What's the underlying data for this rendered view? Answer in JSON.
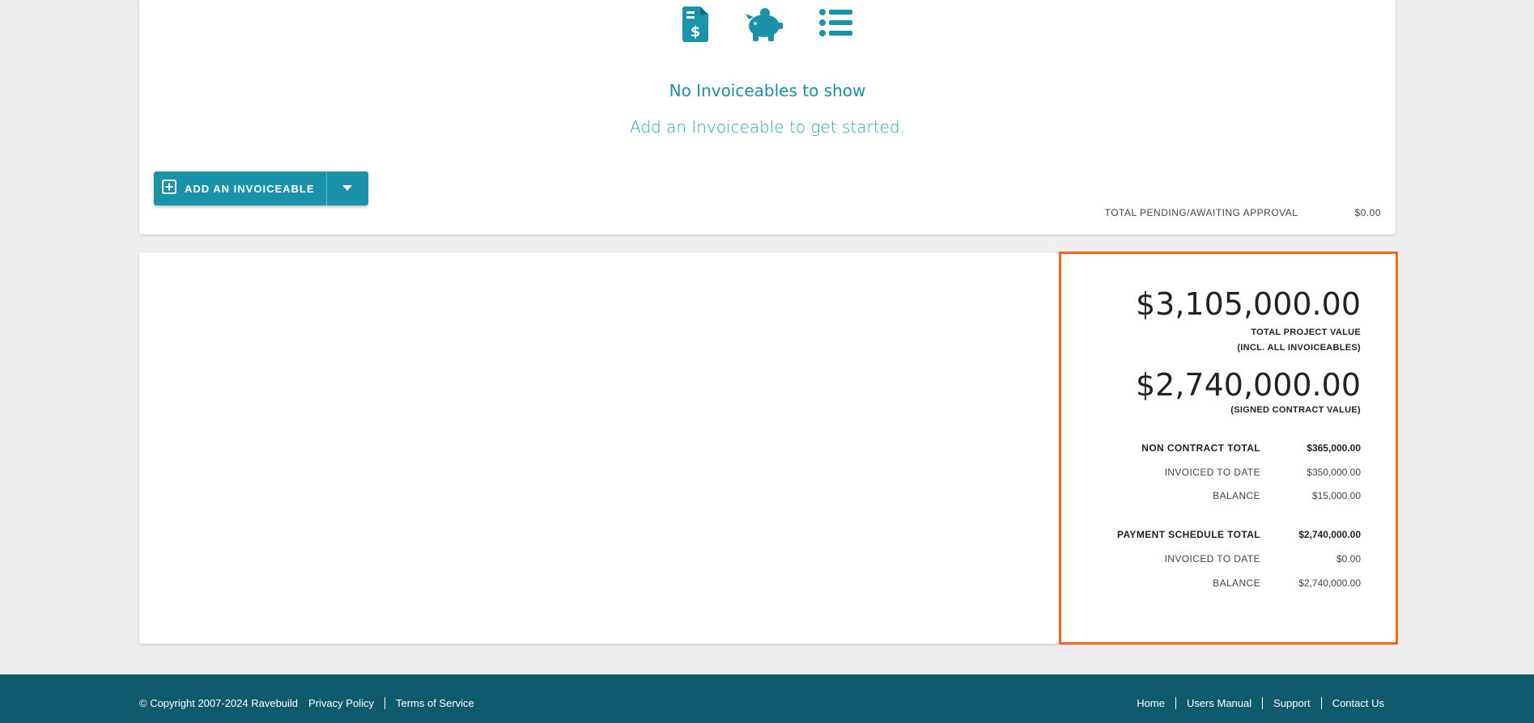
{
  "invoiceables": {
    "empty_title": "No Invoiceables to show",
    "empty_subtitle": "Add an Invoiceable to get started.",
    "add_button_label": "ADD AN INVOICEABLE",
    "pending_label": "TOTAL PENDING/AWAITING APPROVAL",
    "pending_value": "$0.00",
    "icon_color": "#1a93a8"
  },
  "summary": {
    "total_project_value": "$3,105,000.00",
    "total_project_caption_1": "TOTAL PROJECT VALUE",
    "total_project_caption_2": "(INCL. ALL INVOICEABLES)",
    "signed_contract_value": "$2,740,000.00",
    "signed_contract_caption": "(SIGNED CONTRACT VALUE)",
    "non_contract": {
      "total_label": "NON CONTRACT TOTAL",
      "total_value": "$365,000.00",
      "invoiced_label": "INVOICED TO DATE",
      "invoiced_value": "$350,000.00",
      "balance_label": "BALANCE",
      "balance_value": "$15,000.00"
    },
    "payment_schedule": {
      "total_label": "PAYMENT SCHEDULE TOTAL",
      "total_value": "$2,740,000.00",
      "invoiced_label": "INVOICED TO DATE",
      "invoiced_value": "$0.00",
      "balance_label": "BALANCE",
      "balance_value": "$2,740,000.00"
    },
    "highlight_color": "#f26522"
  },
  "footer": {
    "copyright": "© Copyright 2007-2024 Ravebuild",
    "privacy": "Privacy Policy",
    "terms": "Terms of Service",
    "home": "Home",
    "manual": "Users Manual",
    "support": "Support",
    "contact": "Contact Us",
    "background": "#0e5a6d"
  }
}
